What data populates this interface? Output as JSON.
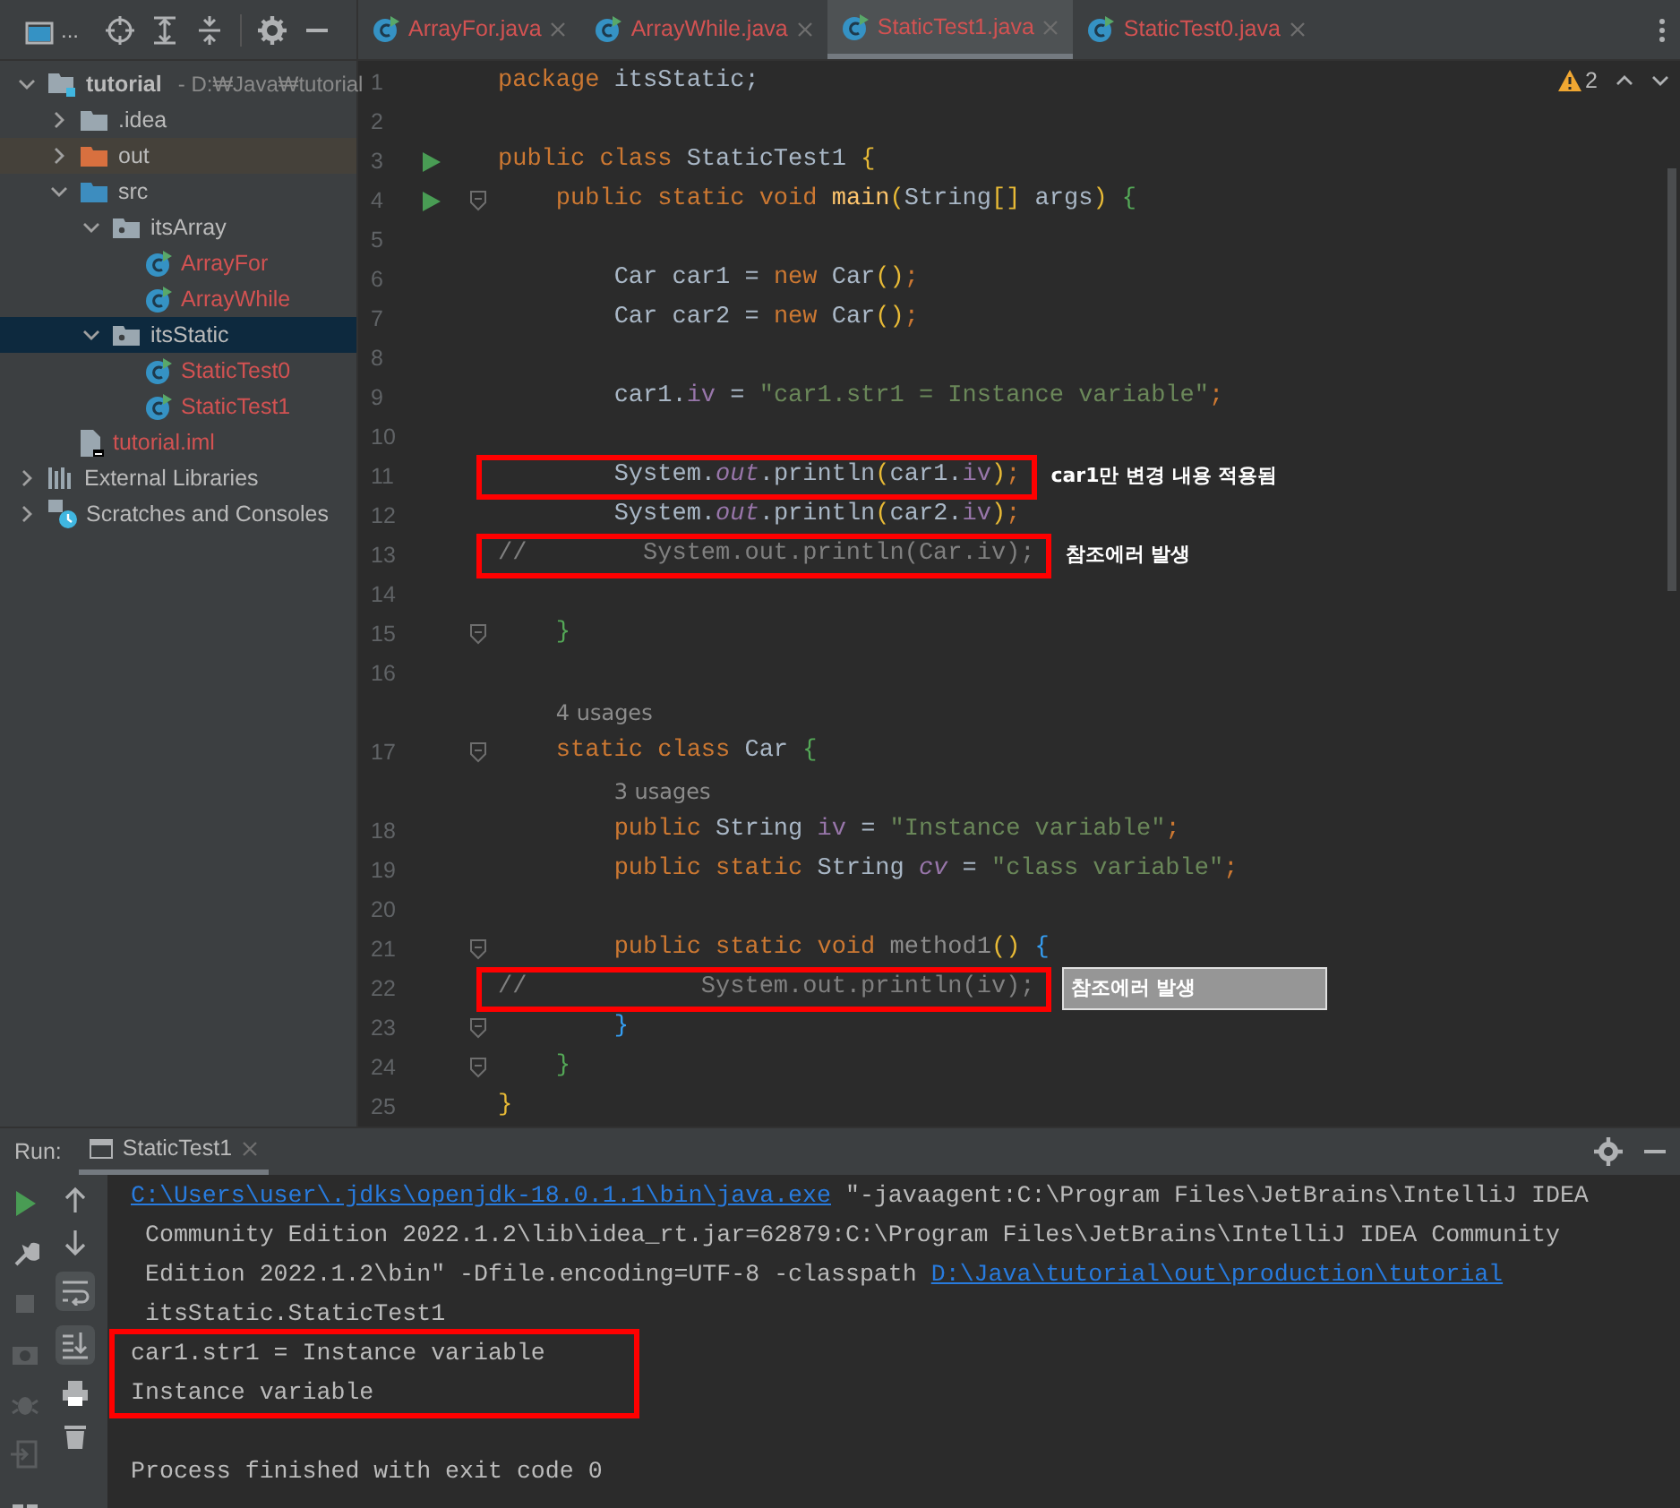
{
  "toolbar": {
    "label": "..."
  },
  "project_tree": [
    {
      "label": "tutorial",
      "hint": "- D:₩Java₩tutorial",
      "kind": "module",
      "expanded": true,
      "selected": false,
      "children": [
        {
          "label": ".idea",
          "kind": "folder",
          "expanded": false,
          "selected": false
        },
        {
          "label": "out",
          "kind": "excluded-folder",
          "expanded": false,
          "selected": false
        },
        {
          "label": "src",
          "kind": "source-folder",
          "expanded": true,
          "selected": false,
          "children": [
            {
              "label": "itsArray",
              "kind": "package",
              "expanded": true,
              "selected": false,
              "children": [
                {
                  "label": "ArrayFor",
                  "kind": "class",
                  "selected": false
                },
                {
                  "label": "ArrayWhile",
                  "kind": "class",
                  "selected": false
                }
              ]
            },
            {
              "label": "itsStatic",
              "kind": "package",
              "expanded": true,
              "selected": true,
              "children": [
                {
                  "label": "StaticTest0",
                  "kind": "class",
                  "selected": false
                },
                {
                  "label": "StaticTest1",
                  "kind": "class",
                  "selected": false
                }
              ]
            }
          ]
        },
        {
          "label": "tutorial.iml",
          "kind": "file",
          "selected": false
        }
      ]
    },
    {
      "label": "External Libraries",
      "kind": "libraries",
      "expanded": false,
      "selected": false
    },
    {
      "label": "Scratches and Consoles",
      "kind": "scratches",
      "expanded": false,
      "selected": false
    }
  ],
  "tabs": [
    {
      "label": "ArrayFor.java",
      "selected": false
    },
    {
      "label": "ArrayWhile.java",
      "selected": false
    },
    {
      "label": "StaticTest1.java",
      "selected": true
    },
    {
      "label": "StaticTest0.java",
      "selected": false
    }
  ],
  "editor": {
    "problems": "2",
    "lines": [
      {
        "kind": "code",
        "number": "1",
        "run": false,
        "fold": false,
        "boxed": false,
        "tokens": [
          {
            "kind": "keyword",
            "text": "package "
          },
          {
            "kind": "plain",
            "text": "itsStatic;"
          }
        ]
      },
      {
        "kind": "code",
        "number": "2",
        "run": false,
        "fold": false,
        "boxed": false
      },
      {
        "kind": "code",
        "number": "3",
        "run": true,
        "fold": false,
        "boxed": false,
        "tokens": [
          {
            "kind": "keyword",
            "text": "public class "
          },
          {
            "kind": "plain",
            "text": "StaticTest1"
          },
          {
            "kind": "brace",
            "color": "#e8ba36",
            "text": " {"
          }
        ]
      },
      {
        "kind": "code",
        "number": "4",
        "run": true,
        "fold": true,
        "boxed": false,
        "tokens": [
          {
            "kind": "keyword",
            "text": "    public static void "
          },
          {
            "kind": "method",
            "text": "main"
          },
          {
            "kind": "brace",
            "color": "#e8ba36",
            "text": "("
          },
          {
            "kind": "plain",
            "text": "String"
          },
          {
            "kind": "brace",
            "color": "#e8ba36",
            "text": "[]"
          },
          {
            "kind": "plain",
            "text": " args"
          },
          {
            "kind": "brace",
            "color": "#e8ba36",
            "text": ")"
          },
          {
            "kind": "brace",
            "color": "#54a857",
            "text": " {"
          }
        ]
      },
      {
        "kind": "code",
        "number": "5",
        "run": false,
        "fold": false,
        "boxed": false
      },
      {
        "kind": "code",
        "number": "6",
        "run": false,
        "fold": false,
        "boxed": false,
        "tokens": [
          {
            "kind": "plain",
            "text": "        Car car1 = "
          },
          {
            "kind": "keyword",
            "text": "new "
          },
          {
            "kind": "plain",
            "text": "Car"
          },
          {
            "kind": "brace",
            "color": "#e8ba36",
            "text": "()"
          },
          {
            "kind": "keyword",
            "text": ";"
          }
        ]
      },
      {
        "kind": "code",
        "number": "7",
        "run": false,
        "fold": false,
        "boxed": false,
        "tokens": [
          {
            "kind": "plain",
            "text": "        Car car2 = "
          },
          {
            "kind": "keyword",
            "text": "new "
          },
          {
            "kind": "plain",
            "text": "Car"
          },
          {
            "kind": "brace",
            "color": "#e8ba36",
            "text": "()"
          },
          {
            "kind": "keyword",
            "text": ";"
          }
        ]
      },
      {
        "kind": "code",
        "number": "8",
        "run": false,
        "fold": false,
        "boxed": false
      },
      {
        "kind": "code",
        "number": "9",
        "run": false,
        "fold": false,
        "boxed": false,
        "tokens": [
          {
            "kind": "plain",
            "text": "        car1."
          },
          {
            "kind": "field",
            "text": "iv"
          },
          {
            "kind": "plain",
            "text": " = "
          },
          {
            "kind": "string",
            "text": "\"car1.str1 = Instance variable\""
          },
          {
            "kind": "keyword",
            "text": ";"
          }
        ]
      },
      {
        "kind": "code",
        "number": "10",
        "run": false,
        "fold": false,
        "boxed": false
      },
      {
        "kind": "code",
        "number": "11",
        "run": false,
        "fold": false,
        "boxed": true,
        "note": {
          "kind": "text",
          "text": "car1만 변경 내용 적용됨"
        },
        "tokens": [
          {
            "kind": "plain",
            "text": "        System."
          },
          {
            "kind": "static-field",
            "text": "out"
          },
          {
            "kind": "plain",
            "text": ".println"
          },
          {
            "kind": "brace",
            "color": "#e8ba36",
            "text": "("
          },
          {
            "kind": "plain",
            "text": "car1."
          },
          {
            "kind": "field",
            "text": "iv"
          },
          {
            "kind": "brace",
            "color": "#e8ba36",
            "text": ")"
          },
          {
            "kind": "keyword",
            "text": ";"
          }
        ]
      },
      {
        "kind": "code",
        "number": "12",
        "run": false,
        "fold": false,
        "boxed": false,
        "tokens": [
          {
            "kind": "plain",
            "text": "        System."
          },
          {
            "kind": "static-field",
            "text": "out"
          },
          {
            "kind": "plain",
            "text": ".println"
          },
          {
            "kind": "brace",
            "color": "#e8ba36",
            "text": "("
          },
          {
            "kind": "plain",
            "text": "car2."
          },
          {
            "kind": "field",
            "text": "iv"
          },
          {
            "kind": "brace",
            "color": "#e8ba36",
            "text": ")"
          },
          {
            "kind": "keyword",
            "text": ";"
          }
        ]
      },
      {
        "kind": "code",
        "number": "13",
        "run": false,
        "fold": false,
        "boxed": true,
        "note": {
          "kind": "text",
          "text": "참조에러 발생"
        },
        "tokens": [
          {
            "kind": "comment",
            "text": "//        System.out.println(Car.iv);"
          }
        ]
      },
      {
        "kind": "code",
        "number": "14",
        "run": false,
        "fold": false,
        "boxed": false
      },
      {
        "kind": "code",
        "number": "15",
        "run": false,
        "fold": true,
        "boxed": false,
        "tokens": [
          {
            "kind": "brace",
            "color": "#54a857",
            "text": "    }"
          }
        ]
      },
      {
        "kind": "code",
        "number": "16",
        "run": false,
        "fold": false,
        "boxed": false
      },
      {
        "kind": "hint",
        "tokens": [
          {
            "kind": "hint",
            "text": "    4 usages"
          }
        ]
      },
      {
        "kind": "code",
        "number": "17",
        "run": false,
        "fold": true,
        "boxed": false,
        "tokens": [
          {
            "kind": "keyword",
            "text": "    static class "
          },
          {
            "kind": "plain",
            "text": "Car"
          },
          {
            "kind": "brace",
            "color": "#54a857",
            "text": " {"
          }
        ]
      },
      {
        "kind": "hint",
        "tokens": [
          {
            "kind": "hint",
            "text": "        3 usages"
          }
        ]
      },
      {
        "kind": "code",
        "number": "18",
        "run": false,
        "fold": false,
        "boxed": false,
        "tokens": [
          {
            "kind": "keyword",
            "text": "        public "
          },
          {
            "kind": "plain",
            "text": "String "
          },
          {
            "kind": "field",
            "text": "iv"
          },
          {
            "kind": "plain",
            "text": " = "
          },
          {
            "kind": "string",
            "text": "\"Instance variable\""
          },
          {
            "kind": "keyword",
            "text": ";"
          }
        ]
      },
      {
        "kind": "code",
        "number": "19",
        "run": false,
        "fold": false,
        "boxed": false,
        "tokens": [
          {
            "kind": "keyword",
            "text": "        public static "
          },
          {
            "kind": "plain",
            "text": "String "
          },
          {
            "kind": "static-field",
            "text": "cv"
          },
          {
            "kind": "plain",
            "text": " = "
          },
          {
            "kind": "string",
            "text": "\"class variable\""
          },
          {
            "kind": "keyword",
            "text": ";"
          }
        ]
      },
      {
        "kind": "code",
        "number": "20",
        "run": false,
        "fold": false,
        "boxed": false
      },
      {
        "kind": "code",
        "number": "21",
        "run": false,
        "fold": true,
        "boxed": false,
        "tokens": [
          {
            "kind": "keyword",
            "text": "        public static void "
          },
          {
            "kind": "unused",
            "text": "method1"
          },
          {
            "kind": "brace",
            "color": "#e8ba36",
            "text": "()"
          },
          {
            "kind": "brace",
            "color": "#359ff4",
            "text": " {"
          }
        ]
      },
      {
        "kind": "code",
        "number": "22",
        "run": false,
        "fold": false,
        "boxed": true,
        "note": {
          "kind": "tag",
          "text": "참조에러 발생"
        },
        "tokens": [
          {
            "kind": "comment",
            "text": "//            System.out.println(iv);"
          }
        ]
      },
      {
        "kind": "code",
        "number": "23",
        "run": false,
        "fold": true,
        "boxed": false,
        "tokens": [
          {
            "kind": "brace",
            "color": "#359ff4",
            "text": "        }"
          }
        ]
      },
      {
        "kind": "code",
        "number": "24",
        "run": false,
        "fold": true,
        "boxed": false,
        "tokens": [
          {
            "kind": "brace",
            "color": "#54a857",
            "text": "    }"
          }
        ]
      },
      {
        "kind": "code",
        "number": "25",
        "run": false,
        "fold": false,
        "boxed": false,
        "tokens": [
          {
            "kind": "brace",
            "color": "#e8ba36",
            "text": "}"
          }
        ]
      }
    ]
  },
  "run_panel": {
    "label": "Run:",
    "tab": "StaticTest1",
    "output": [
      {
        "boxed": false,
        "segments": [
          {
            "kind": "link",
            "text": "C:\\Users\\user\\.jdks\\openjdk-18.0.1.1\\bin\\java.exe"
          },
          {
            "kind": "text",
            "text": " \"-javaagent:C:\\Program Files\\JetBrains\\IntelliJ IDEA"
          }
        ]
      },
      {
        "boxed": false,
        "segments": [
          {
            "kind": "text",
            "text": " Community Edition 2022.1.2\\lib\\idea_rt.jar=62879:C:\\Program Files\\JetBrains\\IntelliJ IDEA Community"
          }
        ]
      },
      {
        "boxed": false,
        "segments": [
          {
            "kind": "text",
            "text": " Edition 2022.1.2\\bin\" -Dfile.encoding=UTF-8 -classpath "
          },
          {
            "kind": "link",
            "text": "D:\\Java\\tutorial\\out\\production\\tutorial"
          }
        ]
      },
      {
        "boxed": false,
        "segments": [
          {
            "kind": "text",
            "text": " itsStatic.StaticTest1"
          }
        ]
      },
      {
        "boxed": true,
        "segments": [
          {
            "kind": "text",
            "text": "car1.str1 = Instance variable"
          }
        ]
      },
      {
        "boxed": true,
        "segments": [
          {
            "kind": "text",
            "text": "Instance variable"
          }
        ]
      },
      {
        "boxed": false
      },
      {
        "boxed": false,
        "segments": [
          {
            "kind": "text",
            "text": "Process finished with exit code 0"
          }
        ]
      }
    ]
  }
}
